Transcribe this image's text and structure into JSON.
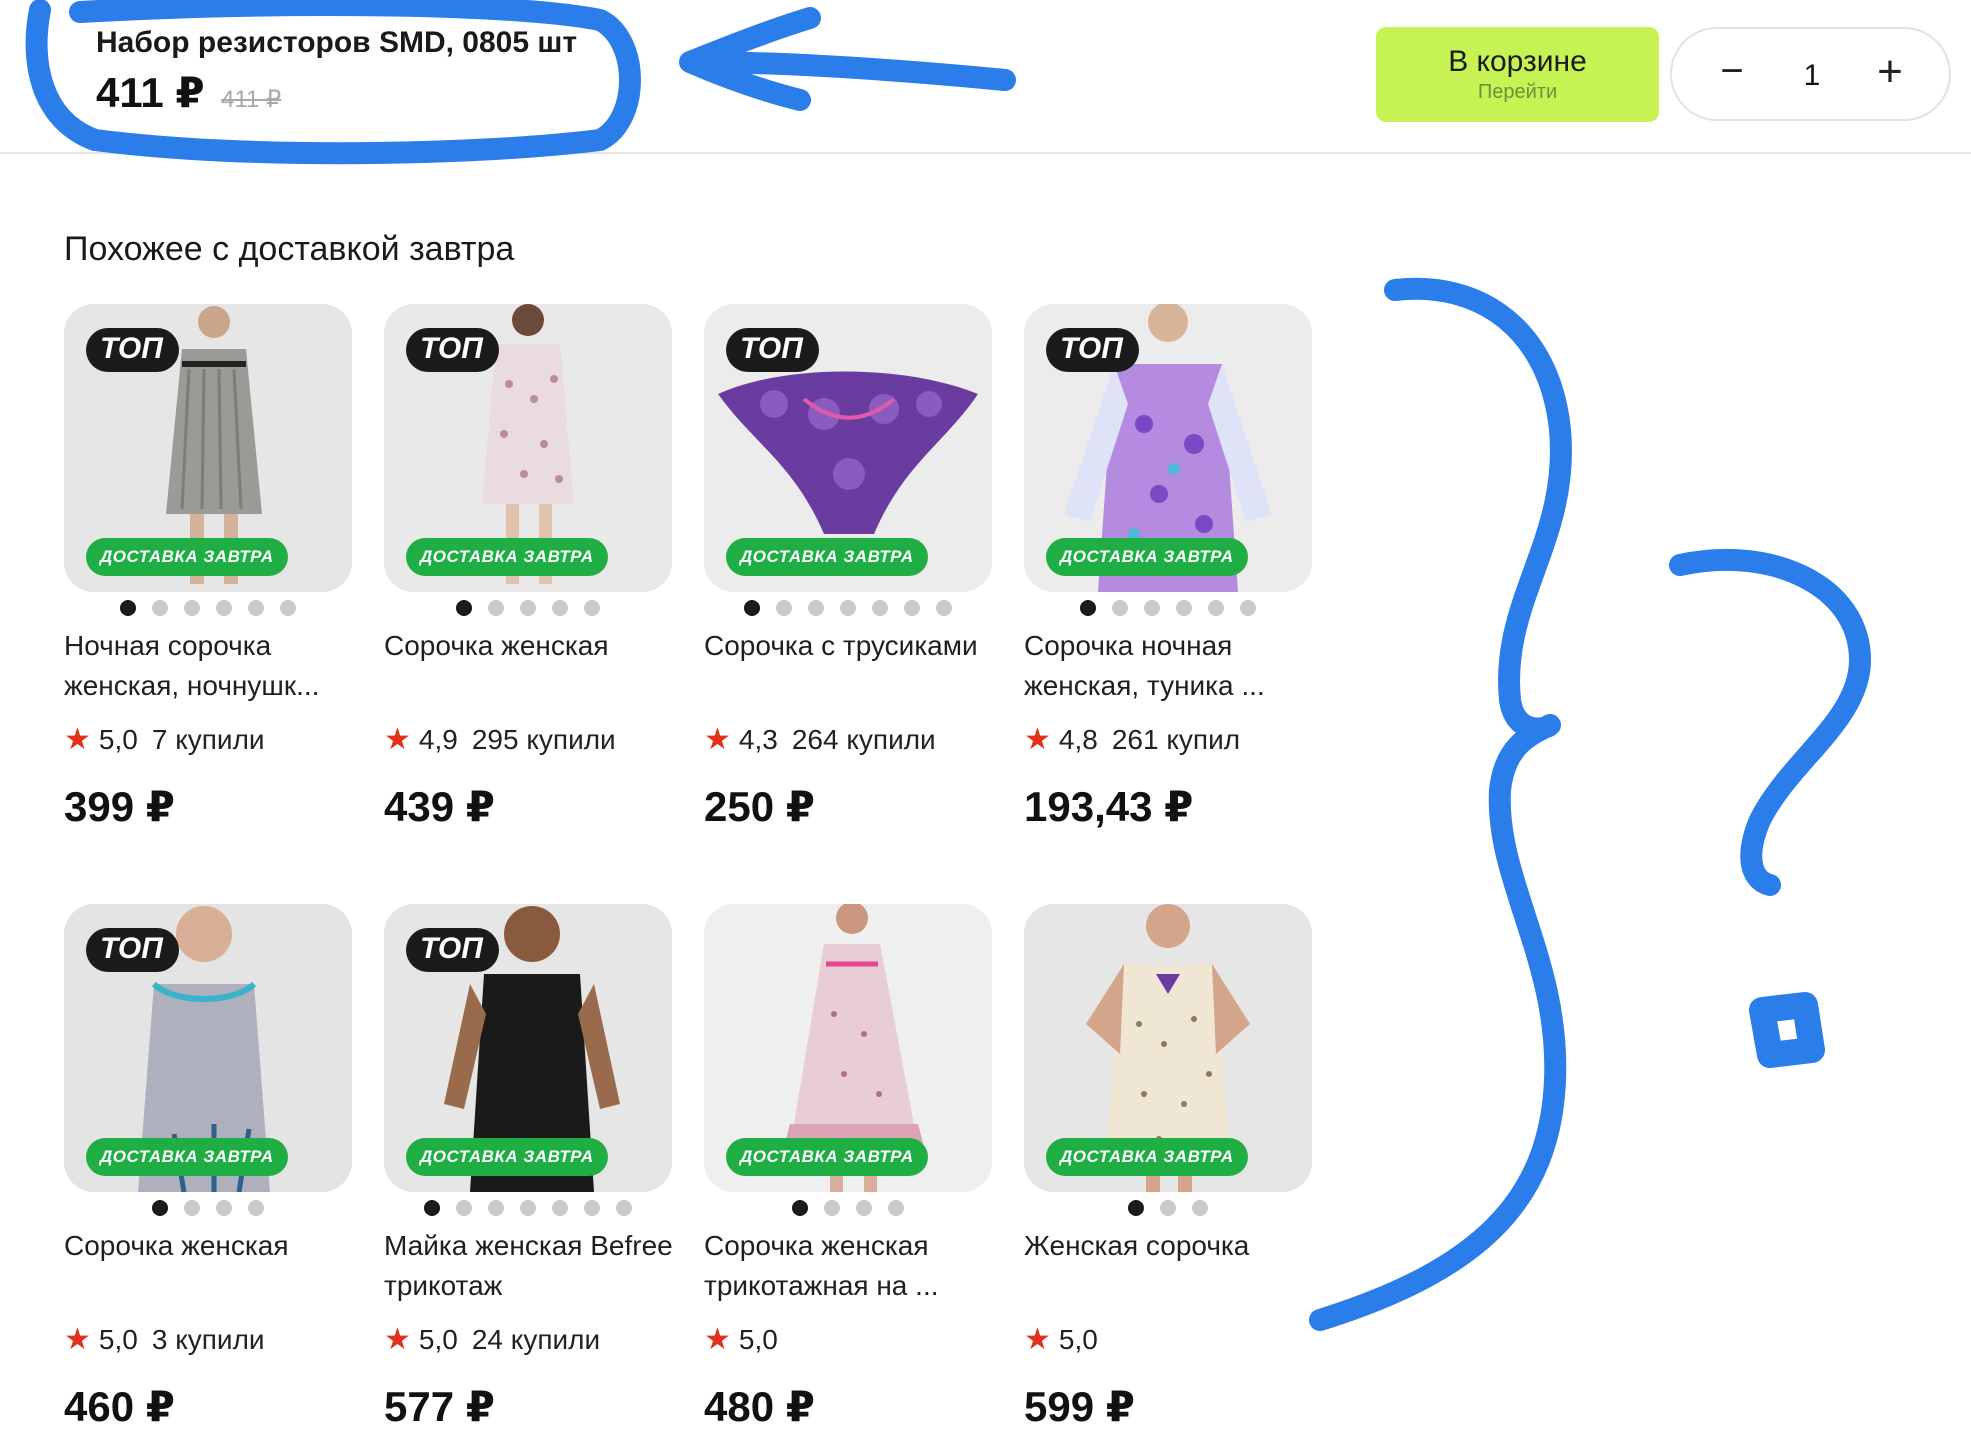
{
  "header": {
    "title": "Набор резисторов SMD, 0805 шт",
    "price": "411 ₽",
    "old_price": "411 ₽"
  },
  "cart_button": {
    "label": "В корзине",
    "sublabel": "Перейти"
  },
  "stepper": {
    "minus": "−",
    "quantity": "1",
    "plus": "+"
  },
  "section_title": "Похожее с доставкой завтра",
  "badges": {
    "top": "ТОП",
    "delivery": "ДОСТАВКА ЗАВТРА"
  },
  "products": [
    {
      "name": "Ночная сорочка женская, ночнушк...",
      "rating": "5,0",
      "buys": "7 купили",
      "price": "399 ₽",
      "top": true,
      "delivery": true,
      "dots": 6,
      "active_dot": 0,
      "image": "striped-nightgown"
    },
    {
      "name": "Сорочка женская",
      "rating": "4,9",
      "buys": "295 купили",
      "price": "439 ₽",
      "top": true,
      "delivery": true,
      "dots": 5,
      "active_dot": 0,
      "image": "pink-floral-nightgown"
    },
    {
      "name": "Сорочка с трусиками",
      "rating": "4,3",
      "buys": "264 купили",
      "price": "250 ₽",
      "top": true,
      "delivery": true,
      "dots": 7,
      "active_dot": 0,
      "image": "purple-lace-panties"
    },
    {
      "name": "Сорочка ночная женская, туника ...",
      "rating": "4,8",
      "buys": "261 купил",
      "price": "193,43 ₽",
      "top": true,
      "delivery": true,
      "dots": 6,
      "active_dot": 0,
      "image": "lilac-print-tunic"
    },
    {
      "name": "Сорочка женская",
      "rating": "5,0",
      "buys": "3 купили",
      "price": "460 ₽",
      "top": true,
      "delivery": true,
      "dots": 4,
      "active_dot": 0,
      "image": "grey-nightgown"
    },
    {
      "name": "Майка женская Befree трикотаж",
      "rating": "5,0",
      "buys": "24 купили",
      "price": "577 ₽",
      "top": true,
      "delivery": true,
      "dots": 7,
      "active_dot": 0,
      "image": "black-tank-top"
    },
    {
      "name": "Сорочка женская трикотажная на ...",
      "rating": "5,0",
      "buys": "",
      "price": "480 ₽",
      "top": false,
      "delivery": true,
      "dots": 4,
      "active_dot": 0,
      "image": "pink-ruffle-nightgown"
    },
    {
      "name": "Женская сорочка",
      "rating": "5,0",
      "buys": "",
      "price": "599 ₽",
      "top": false,
      "delivery": true,
      "dots": 3,
      "active_dot": 0,
      "image": "beige-floral-nightgown"
    }
  ],
  "colors": {
    "cart_button": "#c6f353",
    "delivery_badge": "#1fae44",
    "top_badge": "#1b1b1b",
    "star": "#e2321c",
    "annotation": "#2b7de9"
  }
}
